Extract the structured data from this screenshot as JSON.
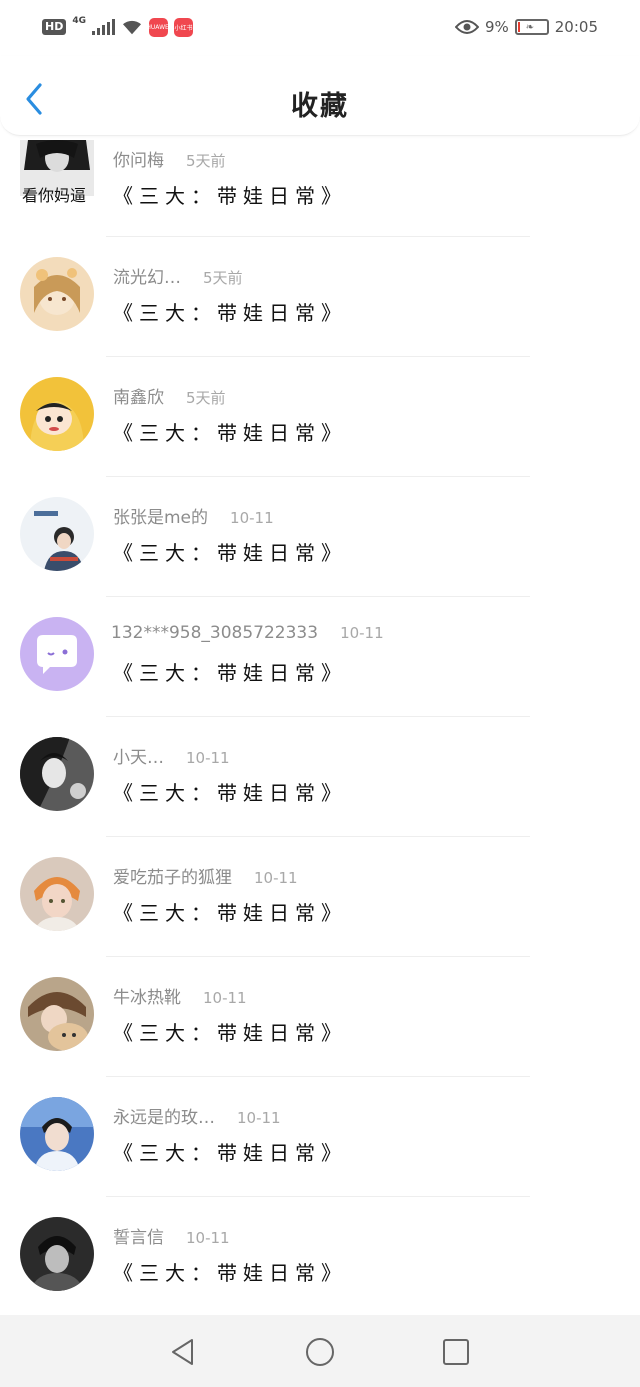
{
  "status_bar": {
    "hd": "HD",
    "network": "4G",
    "app_badge_1": "HUAWEI",
    "app_badge_2": "小红书",
    "battery_percent": "9%",
    "battery_level": 0.09,
    "time": "20:05"
  },
  "header": {
    "title": "收藏"
  },
  "items": [
    {
      "user": "你问梅",
      "time": "5天前",
      "post": "《三大：带娃日常》",
      "avatar_caption": "看你妈逼"
    },
    {
      "user": "流光幻…",
      "time": "5天前",
      "post": "《三大：带娃日常》"
    },
    {
      "user": "南鑫欣",
      "time": "5天前",
      "post": "《三大：带娃日常》"
    },
    {
      "user": "张张是me的",
      "time": "10-11",
      "post": "《三大：带娃日常》"
    },
    {
      "user": "132***958_3085722333",
      "time": "10-11",
      "post": "《三大：带娃日常》"
    },
    {
      "user": "小天…",
      "time": "10-11",
      "post": "《三大：带娃日常》"
    },
    {
      "user": "爱吃茄子的狐狸",
      "time": "10-11",
      "post": "《三大：带娃日常》"
    },
    {
      "user": "牛冰热靴",
      "time": "10-11",
      "post": "《三大：带娃日常》"
    },
    {
      "user": "永远是的玫…",
      "time": "10-11",
      "post": "《三大：带娃日常》"
    },
    {
      "user": "誓言信",
      "time": "10-11",
      "post": "《三大：带娃日常》"
    }
  ],
  "colors": {
    "accent": "#2a8de0",
    "muted_text": "#8c8c8c",
    "divider": "#eeeeee",
    "nav_bg": "#f3f3f3",
    "chat_avatar_bg": "#c9b3f2"
  }
}
